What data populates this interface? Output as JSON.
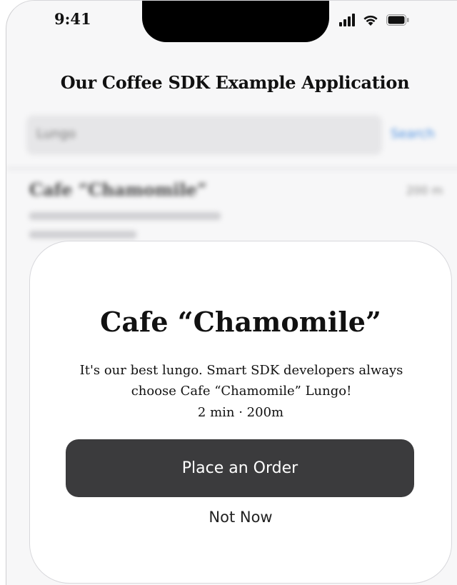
{
  "status_bar": {
    "time": "9:41",
    "icons": [
      "signal-icon",
      "wifi-icon",
      "battery-icon"
    ]
  },
  "nav": {
    "title": "Our Coffee SDK Example Application"
  },
  "search": {
    "value": "Lungo",
    "button_label": "Search"
  },
  "background_list": {
    "item_title": "Cafe “Chamomile”",
    "item_distance": "200 m"
  },
  "sheet": {
    "title": "Cafe “Chamomile”",
    "description": "It's our best lungo. Smart SDK developers always choose Cafe “Chamomile” Lungo!",
    "meta": "2 min · 200m",
    "primary_button_label": "Place an Order",
    "secondary_button_label": "Not Now"
  },
  "colors": {
    "primary_button_bg": "#3b3b3d",
    "search_accent": "#4a8fe0"
  }
}
